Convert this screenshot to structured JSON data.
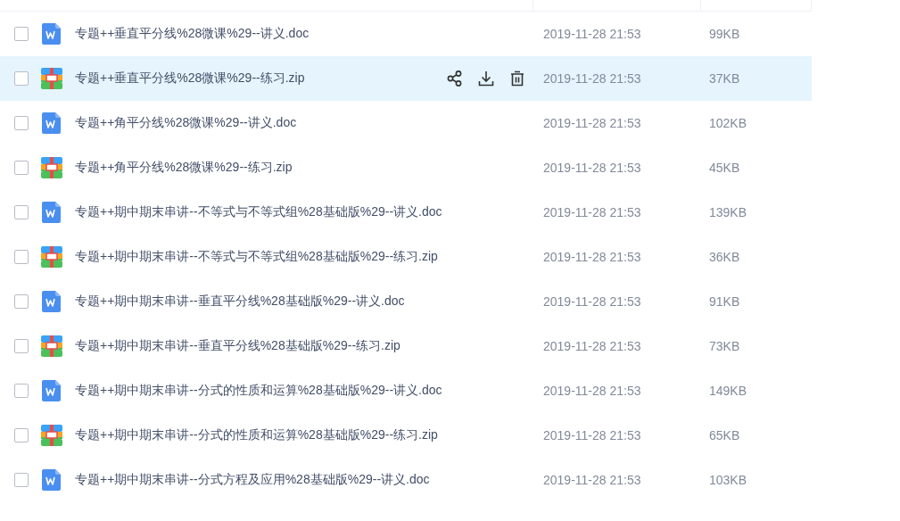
{
  "files": [
    {
      "kind": "doc",
      "name": "专题++垂直平分线%28微课%29--讲义.doc",
      "date": "2019-11-28 21:53",
      "size": "99KB",
      "checked": false,
      "selected": false
    },
    {
      "kind": "zip",
      "name": "专题++垂直平分线%28微课%29--练习.zip",
      "date": "2019-11-28 21:53",
      "size": "37KB",
      "checked": false,
      "selected": true
    },
    {
      "kind": "doc",
      "name": "专题++角平分线%28微课%29--讲义.doc",
      "date": "2019-11-28 21:53",
      "size": "102KB",
      "checked": false,
      "selected": false
    },
    {
      "kind": "zip",
      "name": "专题++角平分线%28微课%29--练习.zip",
      "date": "2019-11-28 21:53",
      "size": "45KB",
      "checked": false,
      "selected": false
    },
    {
      "kind": "doc",
      "name": "专题++期中期末串讲--不等式与不等式组%28基础版%29--讲义.doc",
      "date": "2019-11-28 21:53",
      "size": "139KB",
      "checked": false,
      "selected": false
    },
    {
      "kind": "zip",
      "name": "专题++期中期末串讲--不等式与不等式组%28基础版%29--练习.zip",
      "date": "2019-11-28 21:53",
      "size": "36KB",
      "checked": false,
      "selected": false
    },
    {
      "kind": "doc",
      "name": "专题++期中期末串讲--垂直平分线%28基础版%29--讲义.doc",
      "date": "2019-11-28 21:53",
      "size": "91KB",
      "checked": false,
      "selected": false
    },
    {
      "kind": "zip",
      "name": "专题++期中期末串讲--垂直平分线%28基础版%29--练习.zip",
      "date": "2019-11-28 21:53",
      "size": "73KB",
      "checked": false,
      "selected": false
    },
    {
      "kind": "doc",
      "name": "专题++期中期末串讲--分式的性质和运算%28基础版%29--讲义.doc",
      "date": "2019-11-28 21:53",
      "size": "149KB",
      "checked": false,
      "selected": false
    },
    {
      "kind": "zip",
      "name": "专题++期中期末串讲--分式的性质和运算%28基础版%29--练习.zip",
      "date": "2019-11-28 21:53",
      "size": "65KB",
      "checked": false,
      "selected": false
    },
    {
      "kind": "doc",
      "name": "专题++期中期末串讲--分式方程及应用%28基础版%29--讲义.doc",
      "date": "2019-11-28 21:53",
      "size": "103KB",
      "checked": false,
      "selected": false
    }
  ]
}
